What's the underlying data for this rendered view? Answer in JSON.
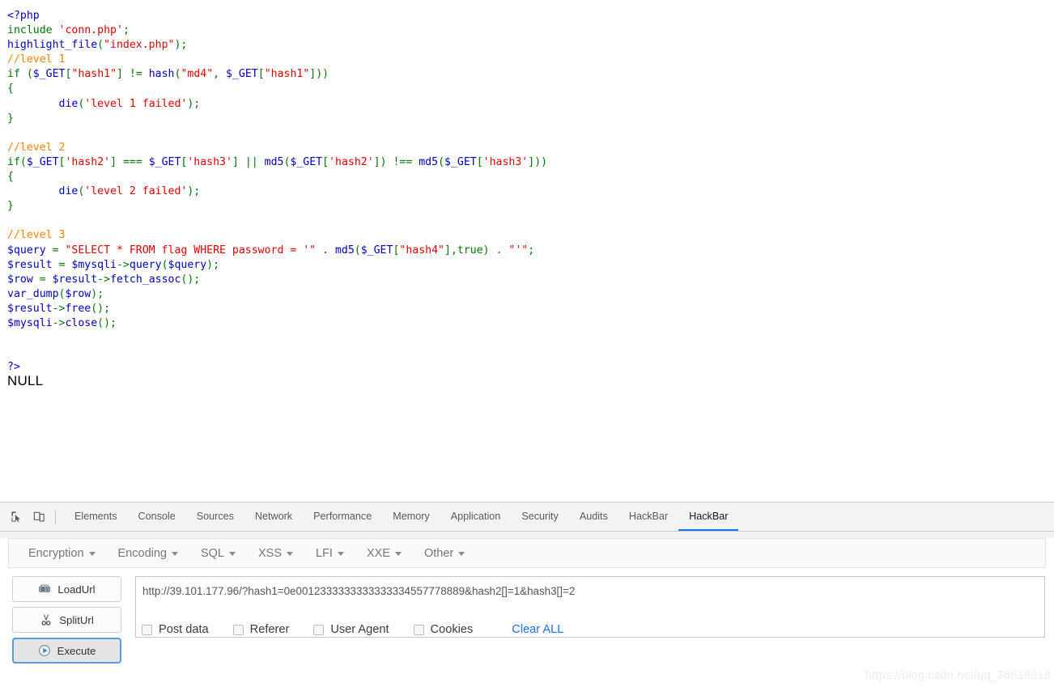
{
  "page": {
    "code_lines": [
      [
        {
          "t": "<?php",
          "c": "def"
        }
      ],
      [
        {
          "t": "include ",
          "c": "kw"
        },
        {
          "t": "'conn.php'",
          "c": "str"
        },
        {
          "t": ";",
          "c": "kw"
        }
      ],
      [
        {
          "t": "highlight_file",
          "c": "def"
        },
        {
          "t": "(",
          "c": "kw"
        },
        {
          "t": "\"index.php\"",
          "c": "str"
        },
        {
          "t": ");",
          "c": "kw"
        }
      ],
      [
        {
          "t": "//level 1",
          "c": "cmt"
        }
      ],
      [
        {
          "t": "if ",
          "c": "kw"
        },
        {
          "t": "(",
          "c": "kw"
        },
        {
          "t": "$_GET",
          "c": "var"
        },
        {
          "t": "[",
          "c": "kw"
        },
        {
          "t": "\"hash1\"",
          "c": "str"
        },
        {
          "t": "] != ",
          "c": "kw"
        },
        {
          "t": "hash",
          "c": "def"
        },
        {
          "t": "(",
          "c": "kw"
        },
        {
          "t": "\"md4\"",
          "c": "str"
        },
        {
          "t": ", ",
          "c": "kw"
        },
        {
          "t": "$_GET",
          "c": "var"
        },
        {
          "t": "[",
          "c": "kw"
        },
        {
          "t": "\"hash1\"",
          "c": "str"
        },
        {
          "t": "]))",
          "c": "kw"
        }
      ],
      [
        {
          "t": "{",
          "c": "kw"
        }
      ],
      [
        {
          "t": "        die",
          "c": "def"
        },
        {
          "t": "(",
          "c": "kw"
        },
        {
          "t": "'level 1 failed'",
          "c": "str"
        },
        {
          "t": ");",
          "c": "kw"
        }
      ],
      [
        {
          "t": "}",
          "c": "kw"
        }
      ],
      [
        {
          "t": "",
          "c": "kw"
        }
      ],
      [
        {
          "t": "//level 2",
          "c": "cmt"
        }
      ],
      [
        {
          "t": "if(",
          "c": "kw"
        },
        {
          "t": "$_GET",
          "c": "var"
        },
        {
          "t": "[",
          "c": "kw"
        },
        {
          "t": "'hash2'",
          "c": "str"
        },
        {
          "t": "] === ",
          "c": "kw"
        },
        {
          "t": "$_GET",
          "c": "var"
        },
        {
          "t": "[",
          "c": "kw"
        },
        {
          "t": "'hash3'",
          "c": "str"
        },
        {
          "t": "] || ",
          "c": "kw"
        },
        {
          "t": "md5",
          "c": "def"
        },
        {
          "t": "(",
          "c": "kw"
        },
        {
          "t": "$_GET",
          "c": "var"
        },
        {
          "t": "[",
          "c": "kw"
        },
        {
          "t": "'hash2'",
          "c": "str"
        },
        {
          "t": "]) !== ",
          "c": "kw"
        },
        {
          "t": "md5",
          "c": "def"
        },
        {
          "t": "(",
          "c": "kw"
        },
        {
          "t": "$_GET",
          "c": "var"
        },
        {
          "t": "[",
          "c": "kw"
        },
        {
          "t": "'hash3'",
          "c": "str"
        },
        {
          "t": "]))",
          "c": "kw"
        }
      ],
      [
        {
          "t": "{",
          "c": "kw"
        }
      ],
      [
        {
          "t": "        die",
          "c": "def"
        },
        {
          "t": "(",
          "c": "kw"
        },
        {
          "t": "'level 2 failed'",
          "c": "str"
        },
        {
          "t": ");",
          "c": "kw"
        }
      ],
      [
        {
          "t": "}",
          "c": "kw"
        }
      ],
      [
        {
          "t": "",
          "c": "kw"
        }
      ],
      [
        {
          "t": "//level 3",
          "c": "cmt"
        }
      ],
      [
        {
          "t": "$query",
          "c": "var"
        },
        {
          "t": " = ",
          "c": "kw"
        },
        {
          "t": "\"SELECT * FROM flag WHERE password = '\"",
          "c": "str"
        },
        {
          "t": " . ",
          "c": "kw"
        },
        {
          "t": "md5",
          "c": "def"
        },
        {
          "t": "(",
          "c": "kw"
        },
        {
          "t": "$_GET",
          "c": "var"
        },
        {
          "t": "[",
          "c": "kw"
        },
        {
          "t": "\"hash4\"",
          "c": "str"
        },
        {
          "t": "],",
          "c": "kw"
        },
        {
          "t": "true",
          "c": "kw"
        },
        {
          "t": ") . ",
          "c": "kw"
        },
        {
          "t": "\"'\"",
          "c": "str"
        },
        {
          "t": ";",
          "c": "kw"
        }
      ],
      [
        {
          "t": "$result",
          "c": "var"
        },
        {
          "t": " = ",
          "c": "kw"
        },
        {
          "t": "$mysqli",
          "c": "var"
        },
        {
          "t": "->",
          "c": "kw"
        },
        {
          "t": "query",
          "c": "def"
        },
        {
          "t": "(",
          "c": "kw"
        },
        {
          "t": "$query",
          "c": "var"
        },
        {
          "t": ");",
          "c": "kw"
        }
      ],
      [
        {
          "t": "$row",
          "c": "var"
        },
        {
          "t": " = ",
          "c": "kw"
        },
        {
          "t": "$result",
          "c": "var"
        },
        {
          "t": "->",
          "c": "kw"
        },
        {
          "t": "fetch_assoc",
          "c": "def"
        },
        {
          "t": "();",
          "c": "kw"
        }
      ],
      [
        {
          "t": "var_dump",
          "c": "def"
        },
        {
          "t": "(",
          "c": "kw"
        },
        {
          "t": "$row",
          "c": "var"
        },
        {
          "t": ");",
          "c": "kw"
        }
      ],
      [
        {
          "t": "$result",
          "c": "var"
        },
        {
          "t": "->",
          "c": "kw"
        },
        {
          "t": "free",
          "c": "def"
        },
        {
          "t": "();",
          "c": "kw"
        }
      ],
      [
        {
          "t": "$mysqli",
          "c": "var"
        },
        {
          "t": "->",
          "c": "kw"
        },
        {
          "t": "close",
          "c": "def"
        },
        {
          "t": "();",
          "c": "kw"
        }
      ],
      [
        {
          "t": "",
          "c": "kw"
        }
      ],
      [
        {
          "t": "",
          "c": "kw"
        }
      ],
      [
        {
          "t": "?>",
          "c": "def"
        }
      ]
    ],
    "output": "NULL"
  },
  "devtools": {
    "inspect_icon": "inspect-element-icon",
    "device_icon": "device-toolbar-icon",
    "tabs": [
      {
        "label": "Elements",
        "active": false
      },
      {
        "label": "Console",
        "active": false
      },
      {
        "label": "Sources",
        "active": false
      },
      {
        "label": "Network",
        "active": false
      },
      {
        "label": "Performance",
        "active": false
      },
      {
        "label": "Memory",
        "active": false
      },
      {
        "label": "Application",
        "active": false
      },
      {
        "label": "Security",
        "active": false
      },
      {
        "label": "Audits",
        "active": false
      },
      {
        "label": "HackBar",
        "active": false
      },
      {
        "label": "HackBar",
        "active": true
      }
    ],
    "active_tab_accent": "#1a73e8"
  },
  "hackbar": {
    "menu": [
      {
        "label": "Encryption"
      },
      {
        "label": "Encoding"
      },
      {
        "label": "SQL"
      },
      {
        "label": "XSS"
      },
      {
        "label": "LFI"
      },
      {
        "label": "XXE"
      },
      {
        "label": "Other"
      }
    ],
    "buttons": [
      {
        "label": "LoadUrl",
        "icon": "load-url-icon",
        "focused": false
      },
      {
        "label": "SplitUrl",
        "icon": "split-url-icon",
        "focused": false
      },
      {
        "label": "Execute",
        "icon": "execute-play-icon",
        "focused": true
      }
    ],
    "url_value": "http://39.101.177.96/?hash1=0e0012333333333333334557778889&hash2[]=1&hash3[]=2",
    "options": [
      {
        "label": "Post data",
        "checked": false
      },
      {
        "label": "Referer",
        "checked": false
      },
      {
        "label": "User Agent",
        "checked": false
      },
      {
        "label": "Cookies",
        "checked": false
      }
    ],
    "clear_all_label": "Clear ALL",
    "clear_all_color": "#1a73e8"
  },
  "watermark": "https://blog.csdn.net/qq_36618918"
}
